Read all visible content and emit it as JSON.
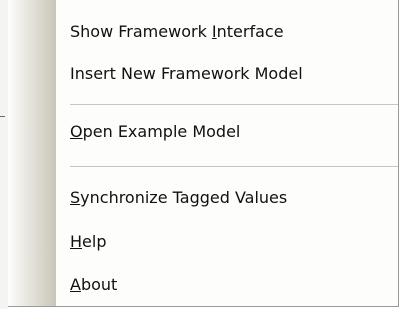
{
  "menu": {
    "items": [
      {
        "pre": "Show Framework ",
        "acc": "I",
        "post": "nterface"
      },
      {
        "pre": "Insert New Framework Model",
        "acc": "",
        "post": ""
      },
      {
        "pre": "",
        "acc": "O",
        "post": "pen Example Model"
      },
      {
        "pre": "",
        "acc": "S",
        "post": "ynchronize Tagged Values"
      },
      {
        "pre": "",
        "acc": "H",
        "post": "elp"
      },
      {
        "pre": "",
        "acc": "A",
        "post": "bout"
      }
    ]
  }
}
